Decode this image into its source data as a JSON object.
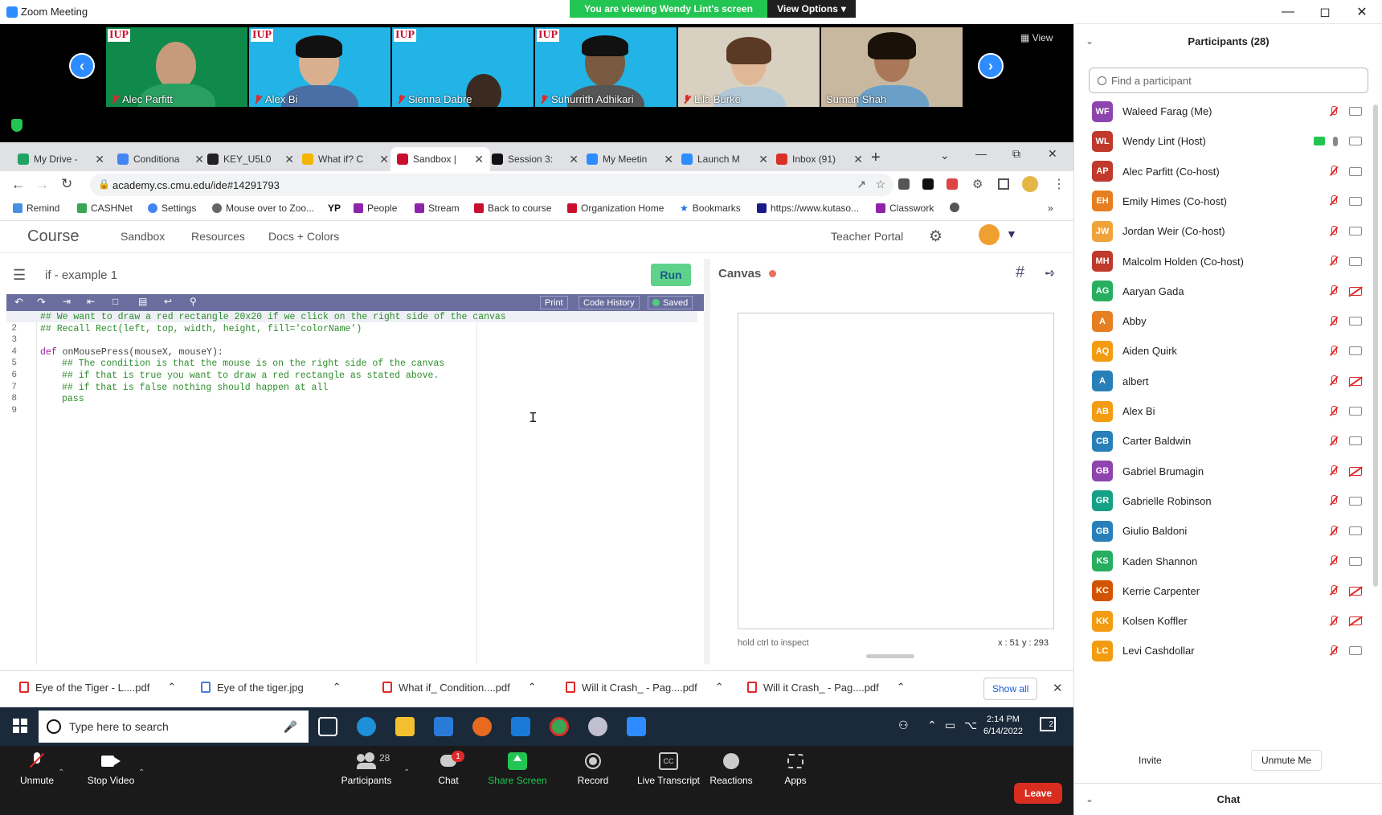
{
  "window": {
    "title": "Zoom Meeting"
  },
  "banner": {
    "viewing": "You are viewing Wendy Lint's screen",
    "view_options": "View Options"
  },
  "strip": {
    "view_label": "View",
    "tiles": [
      {
        "name": "Alec Parfitt"
      },
      {
        "name": "Alex Bi"
      },
      {
        "name": "Sienna Dabre"
      },
      {
        "name": "Suhurrith Adhikari"
      },
      {
        "name": "Lila Burke"
      },
      {
        "name": "Suman Shah"
      }
    ],
    "logo_text": "IUP"
  },
  "browser": {
    "tabs": [
      {
        "title": "My Drive -",
        "color": "#1fa463"
      },
      {
        "title": "Conditiona",
        "color": "#4285f4"
      },
      {
        "title": "KEY_U5L0",
        "color": "#222222"
      },
      {
        "title": "What if? C",
        "color": "#f4b400"
      },
      {
        "title": "Sandbox |",
        "color": "#c8102e"
      },
      {
        "title": "Session 3:",
        "color": "#111111"
      },
      {
        "title": "My Meetin",
        "color": "#2d8cff"
      },
      {
        "title": "Launch M",
        "color": "#2d8cff"
      },
      {
        "title": "Inbox (91)",
        "color": "#d93025"
      }
    ],
    "url": "academy.cs.cmu.edu/ide#14291793",
    "bookmarks": [
      {
        "label": "Remind",
        "color": "#4a90e2"
      },
      {
        "label": "CASHNet",
        "color": "#3aa655"
      },
      {
        "label": "Settings",
        "color": "#4285f4"
      },
      {
        "label": "Mouse over to Zoo...",
        "color": "#666666"
      },
      {
        "label": "",
        "color": "#111111",
        "icon_text": "YP"
      },
      {
        "label": "People",
        "color": "#8e24aa"
      },
      {
        "label": "Stream",
        "color": "#8e24aa"
      },
      {
        "label": "Back to course",
        "color": "#c8102e"
      },
      {
        "label": "Organization Home",
        "color": "#c8102e"
      },
      {
        "label": "Bookmarks",
        "color": "#1a73e8"
      },
      {
        "label": "https://www.kutaso...",
        "color": "#1a1a8a"
      },
      {
        "label": "Classwork",
        "color": "#8e24aa"
      }
    ]
  },
  "cmu": {
    "nav": [
      "Course",
      "Sandbox",
      "Resources",
      "Docs + Colors"
    ],
    "teacher_portal": "Teacher Portal",
    "doc_title": "if - example 1",
    "run": "Run",
    "print": "Print",
    "code_history": "Code History",
    "saved": "Saved",
    "canvas_title": "Canvas",
    "inspect_hint": "hold ctrl to inspect",
    "coords": "x : 51  y : 293",
    "code": [
      {
        "n": "1",
        "text": "## We want to draw a red rectangle 20x20 if we click on the right side of the canvas",
        "type": "comment",
        "indent": 0
      },
      {
        "n": "2",
        "text": "## Recall Rect(left, top, width, height, fill='colorName')",
        "type": "comment",
        "indent": 0
      },
      {
        "n": "3",
        "text": "",
        "type": "plain",
        "indent": 0
      },
      {
        "n": "4",
        "text": "def",
        "rest": " onMousePress(mouseX, mouseY):",
        "type": "def",
        "indent": 0
      },
      {
        "n": "5",
        "text": "## The condition is that the mouse is on the right side of the canvas",
        "type": "comment",
        "indent": 1
      },
      {
        "n": "6",
        "text": "## if that is true you want to draw a red rectangle as stated above.",
        "type": "comment",
        "indent": 1
      },
      {
        "n": "7",
        "text": "## if that is false nothing should happen at all",
        "type": "comment",
        "indent": 1
      },
      {
        "n": "8",
        "text": "pass",
        "type": "comment",
        "indent": 1
      },
      {
        "n": "9",
        "text": "",
        "type": "plain",
        "indent": 0
      }
    ]
  },
  "downloads": {
    "items": [
      "Eye of the Tiger - L....pdf",
      "Eye of the tiger.jpg",
      "What if_ Condition....pdf",
      "Will it Crash_ - Pag....pdf",
      "Will it Crash_ - Pag....pdf"
    ],
    "show_all": "Show all"
  },
  "taskbar": {
    "search_placeholder": "Type here to search",
    "time": "2:14 PM",
    "date": "6/14/2022",
    "notif_count": "2"
  },
  "zoom_bar": {
    "buttons": [
      "Unmute",
      "Stop Video",
      "Participants",
      "Chat",
      "Share Screen",
      "Record",
      "Live Transcript",
      "Reactions",
      "Apps"
    ],
    "participants_count": "28",
    "chat_badge": "1",
    "leave": "Leave"
  },
  "participants": {
    "header": "Participants (28)",
    "find_placeholder": "Find a participant",
    "list": [
      {
        "initials": "WF",
        "name": "Waleed Farag (Me)",
        "color": "#8e44ad",
        "cam_off": false
      },
      {
        "initials": "WL",
        "name": "Wendy Lint (Host)",
        "color": "#c0392b",
        "cam_off": false,
        "sharing": true
      },
      {
        "initials": "AP",
        "name": "Alec Parfitt (Co-host)",
        "color": "#c0392b",
        "cam_off": false
      },
      {
        "initials": "EH",
        "name": "Emily Himes (Co-host)",
        "color": "#e67e22",
        "cam_off": false
      },
      {
        "initials": "JW",
        "name": "Jordan Weir (Co-host)",
        "color": "#f1a33b",
        "cam_off": false
      },
      {
        "initials": "MH",
        "name": "Malcolm Holden (Co-host)",
        "color": "#c0392b",
        "cam_off": false
      },
      {
        "initials": "AG",
        "name": "Aaryan Gada",
        "color": "#27ae60",
        "cam_off": true
      },
      {
        "initials": "A",
        "name": "Abby",
        "color": "#e67e22",
        "cam_off": false
      },
      {
        "initials": "AQ",
        "name": "Aiden Quirk",
        "color": "#f39c12",
        "cam_off": false
      },
      {
        "initials": "A",
        "name": "albert",
        "color": "#2980b9",
        "cam_off": true
      },
      {
        "initials": "AB",
        "name": "Alex Bi",
        "color": "#f39c12",
        "cam_off": false
      },
      {
        "initials": "CB",
        "name": "Carter Baldwin",
        "color": "#2980b9",
        "cam_off": false
      },
      {
        "initials": "GB",
        "name": "Gabriel Brumagin",
        "color": "#8e44ad",
        "cam_off": true
      },
      {
        "initials": "GR",
        "name": "Gabrielle Robinson",
        "color": "#16a085",
        "cam_off": false
      },
      {
        "initials": "GB",
        "name": "Giulio Baldoni",
        "color": "#2980b9",
        "cam_off": false
      },
      {
        "initials": "KS",
        "name": "Kaden Shannon",
        "color": "#27ae60",
        "cam_off": false
      },
      {
        "initials": "KC",
        "name": "Kerrie Carpenter",
        "color": "#d35400",
        "cam_off": true
      },
      {
        "initials": "KK",
        "name": "Kolsen Koffler",
        "color": "#f39c12",
        "cam_off": true
      },
      {
        "initials": "LC",
        "name": "Levi Cashdollar",
        "color": "#f39c12",
        "cam_off": false
      }
    ],
    "invite": "Invite",
    "unmute_me": "Unmute Me",
    "chat_header": "Chat"
  }
}
